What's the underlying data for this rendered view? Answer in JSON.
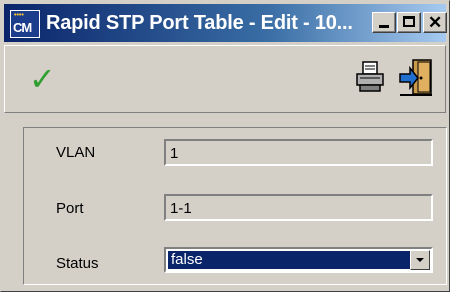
{
  "window": {
    "title": "Rapid STP Port Table - Edit - 10...",
    "app_icon_label": "CM"
  },
  "toolbar": {
    "icons": [
      "checkmark-icon",
      "printer-icon",
      "exit-door-icon"
    ]
  },
  "form": {
    "vlan_label": "VLAN",
    "vlan_value": "1",
    "port_label": "Port",
    "port_value": "1-1",
    "status_label": "Status",
    "status_value": "false"
  },
  "colors": {
    "title_bar": "#0a246a",
    "selection": "#0a246a",
    "check": "#2f9f2f",
    "window_bg": "#d4d0c8"
  }
}
